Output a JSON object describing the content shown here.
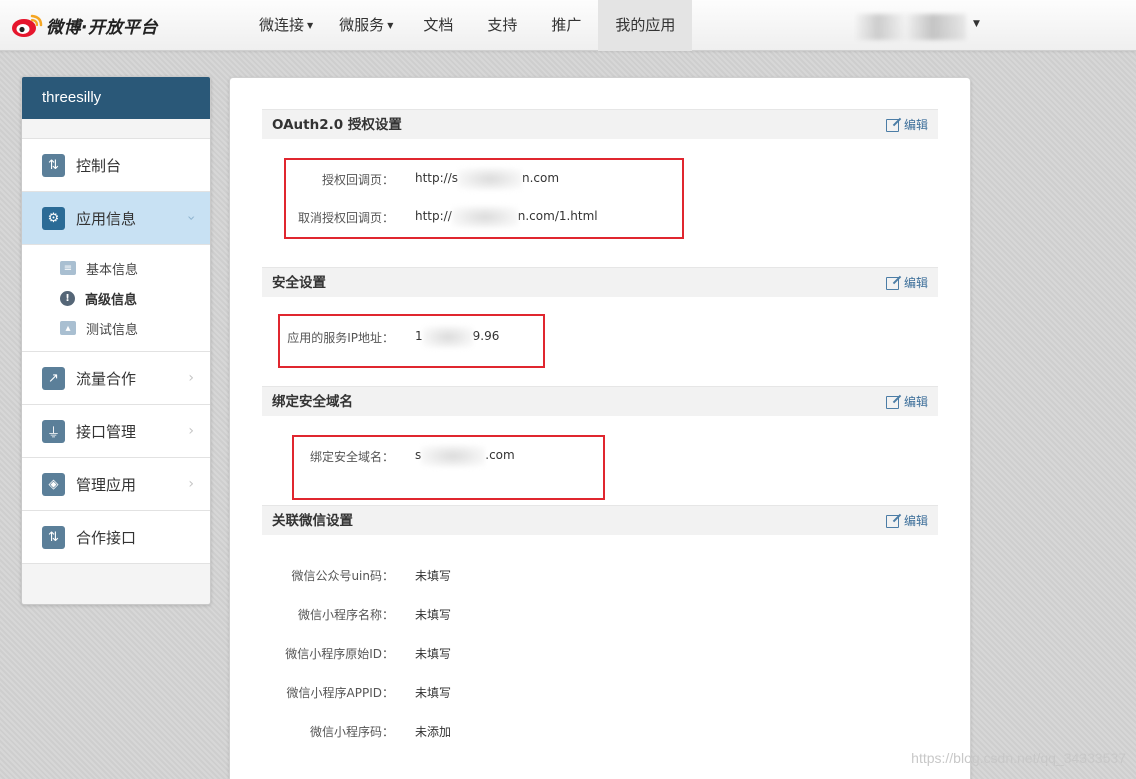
{
  "header": {
    "brand": "微博·开放平台",
    "nav": [
      {
        "label": "微连接",
        "dropdown": true
      },
      {
        "label": "微服务",
        "dropdown": true
      },
      {
        "label": "文档",
        "dropdown": false
      },
      {
        "label": "支持",
        "dropdown": false
      },
      {
        "label": "推广",
        "dropdown": false
      },
      {
        "label": "我的应用",
        "dropdown": false,
        "active": true
      }
    ],
    "user_caret": "▼"
  },
  "sidebar": {
    "app_name": "threesilly",
    "items": [
      {
        "label": "控制台",
        "icon": "dashboard-icon"
      },
      {
        "label": "应用信息",
        "icon": "gear-icon",
        "selected": true
      },
      {
        "label": "流量合作",
        "icon": "chart-icon"
      },
      {
        "label": "接口管理",
        "icon": "plug-icon"
      },
      {
        "label": "管理应用",
        "icon": "layers-icon"
      },
      {
        "label": "合作接口",
        "icon": "sliders-icon"
      }
    ],
    "sub_items": [
      {
        "label": "基本信息",
        "icon": "id-card-icon"
      },
      {
        "label": "高级信息",
        "icon": "alert-icon",
        "current": true
      },
      {
        "label": "测试信息",
        "icon": "image-icon"
      }
    ]
  },
  "main": {
    "edit_label": "编辑",
    "oauth": {
      "title": "OAuth2.0 授权设置",
      "callback_label": "授权回调页：",
      "callback_prefix": "http://s",
      "callback_suffix": "n.com",
      "cancel_label": "取消授权回调页：",
      "cancel_prefix": "http://",
      "cancel_suffix": "n.com/1.html"
    },
    "security": {
      "title": "安全设置",
      "ip_label": "应用的服务IP地址：",
      "ip_prefix": "1",
      "ip_suffix": "9.96"
    },
    "domain": {
      "title": "绑定安全域名",
      "label": "绑定安全域名：",
      "prefix": "s",
      "suffix": ".com"
    },
    "wechat": {
      "title": "关联微信设置",
      "rows": [
        {
          "label": "微信公众号uin码：",
          "value": "未填写"
        },
        {
          "label": "微信小程序名称：",
          "value": "未填写"
        },
        {
          "label": "微信小程序原始ID：",
          "value": "未填写"
        },
        {
          "label": "微信小程序APPID：",
          "value": "未填写"
        },
        {
          "label": "微信小程序码：",
          "value": "未添加"
        }
      ]
    }
  },
  "watermark": "https://blog.csdn.net/qq_34333537",
  "colors": {
    "sidebar_header": "#2a5878",
    "selected_item": "#c8e1f3",
    "highlight_box": "#e0262f",
    "edit_link": "#3d6f9a"
  }
}
